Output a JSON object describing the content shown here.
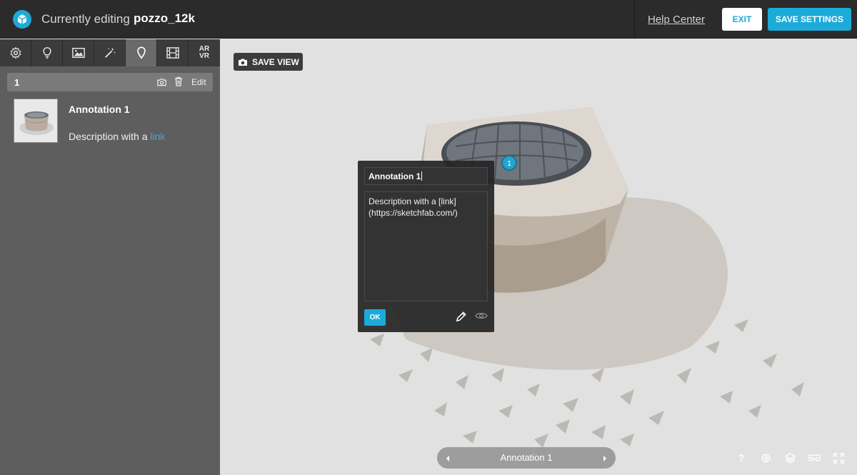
{
  "topbar": {
    "editing_label": "Currently editing",
    "model_name": "pozzo_12k",
    "help_link": "Help Center",
    "exit_label": "EXIT",
    "save_label": "SAVE SETTINGS"
  },
  "sidebar": {
    "tabs": [
      {
        "name": "scene-settings",
        "icon": "gear-icon"
      },
      {
        "name": "lighting",
        "icon": "lightbulb-icon"
      },
      {
        "name": "background",
        "icon": "image-icon"
      },
      {
        "name": "post-processing",
        "icon": "magic-wand-icon"
      },
      {
        "name": "annotations",
        "icon": "map-pin-icon",
        "active": true
      },
      {
        "name": "animation",
        "icon": "film-icon"
      },
      {
        "name": "ar-vr",
        "icon": "ar-vr-icon",
        "label_top": "AR",
        "label_bottom": "VR"
      }
    ],
    "annotation": {
      "number": "1",
      "edit_label": "Edit",
      "title": "Annotation 1",
      "description_prefix": "Description with a",
      "description_link": "link"
    }
  },
  "viewer": {
    "save_view_label": "SAVE VIEW",
    "marker_number": "1",
    "popup": {
      "title_value": "Annotation 1",
      "description_value": "Description with a [link](https://sketchfab.com/)",
      "ok_label": "OK"
    },
    "navigator": {
      "current_label": "Annotation 1"
    },
    "help_glyph": "?"
  },
  "colors": {
    "accent": "#1caad9",
    "topbar_bg": "#2b2b2b",
    "sidebar_bg": "#5e5e5e",
    "viewer_bg": "#e1e1e1"
  }
}
